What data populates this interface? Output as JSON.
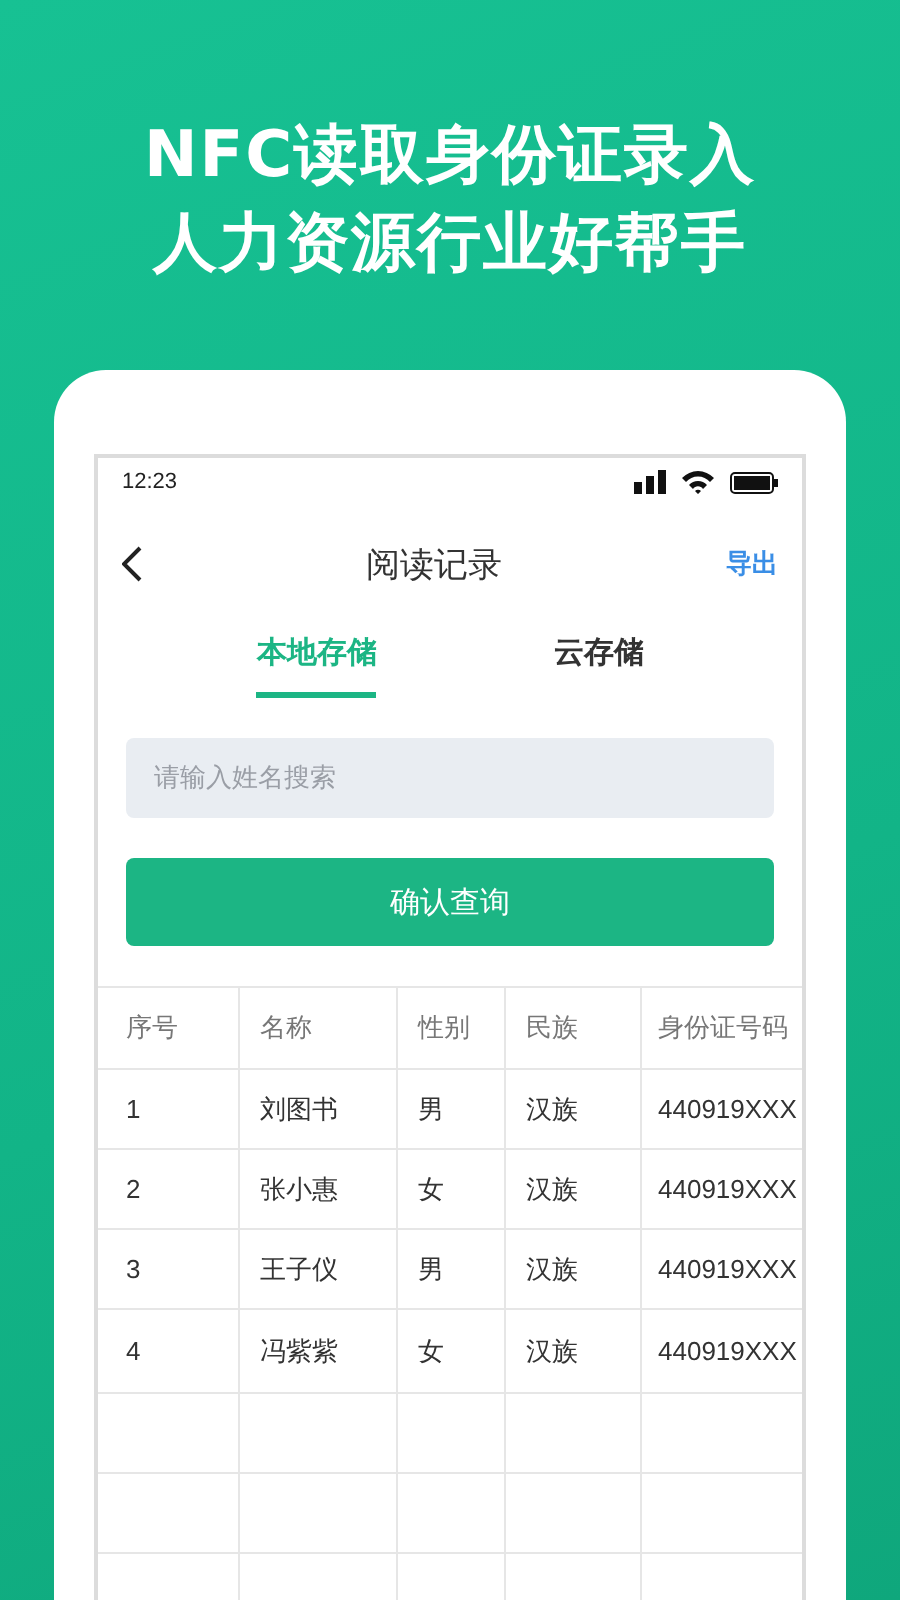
{
  "headline": [
    "NFC读取身份证录入",
    "人力资源行业好帮手"
  ],
  "status_bar": {
    "time": "12:23"
  },
  "nav": {
    "title": "阅读记录",
    "action": "导出"
  },
  "tabs": [
    {
      "label": "本地存储",
      "selected": true
    },
    {
      "label": "云存储",
      "selected": false
    }
  ],
  "search": {
    "placeholder": "请输入姓名搜索"
  },
  "query_button": "确认查询",
  "table": {
    "columns": [
      "序号",
      "名称",
      "性别",
      "民族",
      "身份证号码"
    ],
    "rows": [
      [
        "1",
        "刘图书",
        "男",
        "汉族",
        "440919XXX"
      ],
      [
        "2",
        "张小惠",
        "女",
        "汉族",
        "440919XXX"
      ],
      [
        "3",
        "王子仪",
        "男",
        "汉族",
        "440919XXX"
      ],
      [
        "4",
        "冯紫紫",
        "女",
        "汉族",
        "440919XXX"
      ]
    ]
  }
}
